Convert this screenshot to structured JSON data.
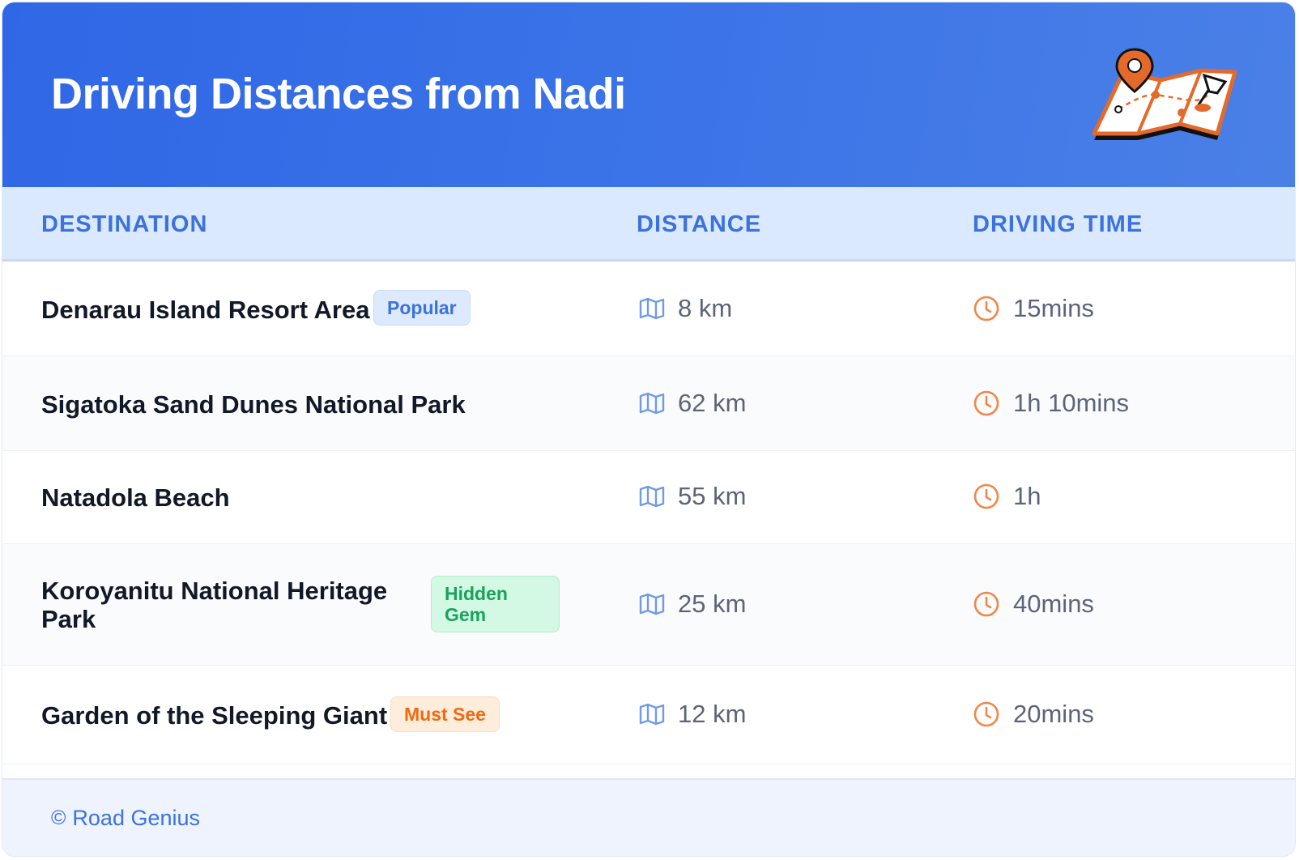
{
  "header": {
    "title": "Driving Distances from Nadi",
    "illustration_icon": "map-with-pin-icon"
  },
  "table": {
    "columns": [
      "DESTINATION",
      "DISTANCE",
      "DRIVING TIME"
    ],
    "rows": [
      {
        "destination": "Denarau Island Resort Area",
        "badge": "Popular",
        "distance": "8 km",
        "time": "15mins"
      },
      {
        "destination": "Sigatoka Sand Dunes National Park",
        "badge": "",
        "distance": "62 km",
        "time": "1h 10mins"
      },
      {
        "destination": "Natadola Beach",
        "badge": "",
        "distance": "55 km",
        "time": "1h"
      },
      {
        "destination_line1": "Koroyanitu National Heritage",
        "destination_line2": "Park",
        "badge_line1": "Hidden",
        "badge_line2": "Gem",
        "distance": "25 km",
        "time": "40mins"
      },
      {
        "destination": "Garden of the Sleeping Giant",
        "badge": "Must See",
        "distance": "12 km",
        "time": "20mins"
      }
    ],
    "distance_icon": "map-icon",
    "time_icon": "clock-icon"
  },
  "footer": {
    "copyright_symbol": "©",
    "text": "Road Genius"
  },
  "colors": {
    "header_blue": "#2f67e6",
    "accent_blue": "#3b72dc",
    "accent_orange": "#ef7d3c",
    "green": "#17a35a"
  }
}
